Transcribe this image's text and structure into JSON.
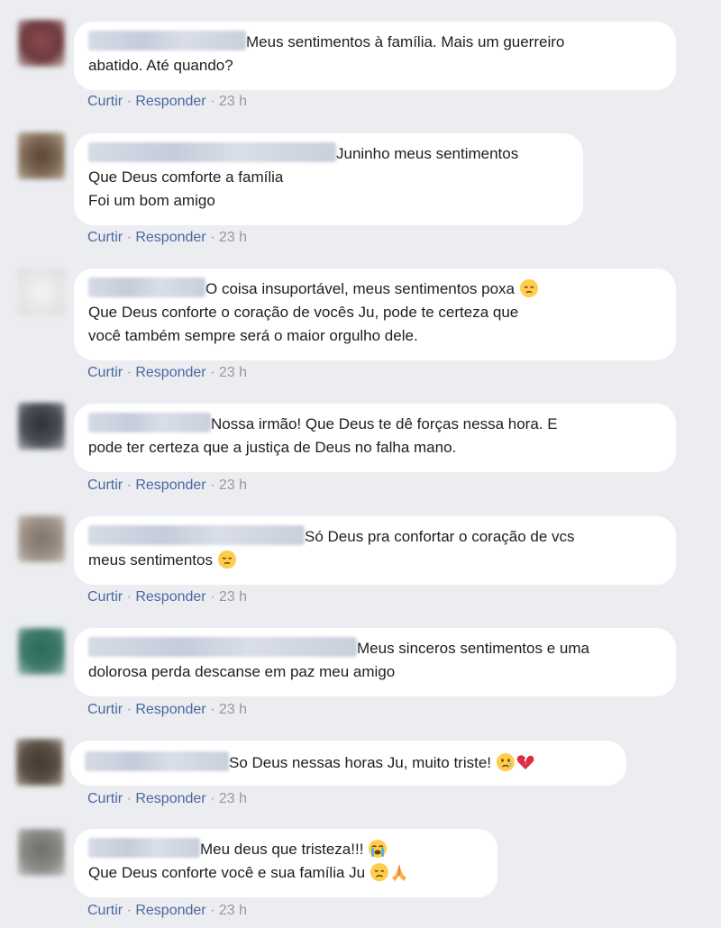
{
  "actions": {
    "like": "Curtir",
    "reply": "Responder",
    "dot": "·"
  },
  "comments": [
    {
      "lines": [
        "Meus sentimentos à família. Mais um guerreiro",
        "abatido. Até quando?"
      ],
      "time": "23 h",
      "avatar_color": "#6e3a3e"
    },
    {
      "lines": [
        "Juninho meus sentimentos",
        "Que Deus comforte a família",
        "Foi um bom amigo"
      ],
      "time": "23 h",
      "avatar_color": "#7c6654"
    },
    {
      "lines": [
        "O coisa insuportável, meus sentimentos poxa",
        "Que Deus conforte o coração de vocês Ju, pode te certeza que",
        "você também sempre será o maior orgulho dele."
      ],
      "time": "23 h",
      "avatar_color": "#e6e6e6",
      "emojis": [
        "pensive-face-icon"
      ]
    },
    {
      "lines": [
        "Nossa irmão! Que Deus te dê forças nessa hora. E",
        "pode ter certeza que a justiça de Deus no falha mano."
      ],
      "time": "23 h",
      "avatar_color": "#4d4f57"
    },
    {
      "lines": [
        "Só Deus pra confortar o coração de vcs",
        "meus sentimentos"
      ],
      "time": "23 h",
      "avatar_color": "#9b8f86",
      "emojis": [
        "pensive-face-icon"
      ]
    },
    {
      "lines": [
        "Meus sinceros sentimentos e uma",
        "dolorosa perda descanse em paz meu amigo"
      ],
      "time": "23 h",
      "avatar_color": "#3f7a6a"
    },
    {
      "lines": [
        "So Deus nessas horas Ju, muito triste!"
      ],
      "time": "23 h",
      "avatar_color": "#5b4f44",
      "emojis": [
        "crying-face-icon",
        "broken-heart-icon"
      ]
    },
    {
      "lines": [
        "Meu deus que tristeza!!!",
        "Que Deus conforte você e sua família Ju"
      ],
      "time": "23 h",
      "avatar_color": "#8a8a86",
      "emojis": [
        "loudly-crying-face-icon",
        "disappointed-face-icon",
        "folded-hands-icon"
      ]
    }
  ]
}
